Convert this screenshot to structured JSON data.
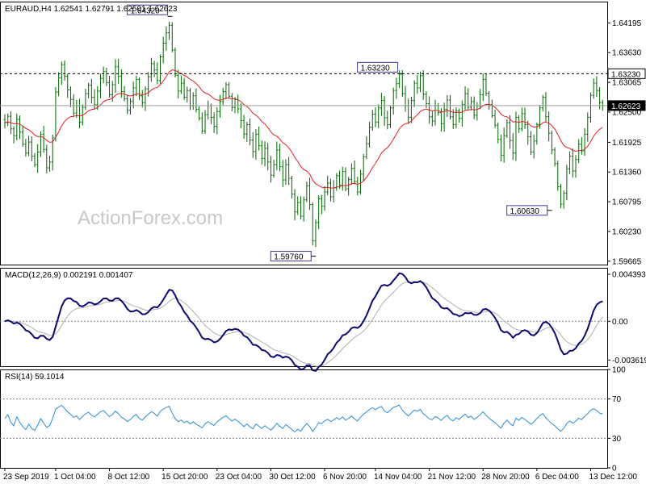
{
  "chart_data": {
    "type": "bar",
    "header": "EURAUD,H4  1.62541 1.62791 1.62501 1.62623",
    "watermark": "ActionForex.com",
    "colors": {
      "price": "#006400",
      "ema": "#e02020",
      "macd": "#0a0a70",
      "signal": "#b0b0b0",
      "rsi": "#2e8bd8",
      "frame": "#000000"
    },
    "price_axis": {
      "range": [
        1.596,
        1.646
      ],
      "ticks": [
        "1.64195",
        "1.63630",
        "1.63065",
        "1.62500",
        "1.61925",
        "1.61360",
        "1.60795",
        "1.60230",
        "1.59665"
      ],
      "tick_values": [
        1.64195,
        1.6363,
        1.63065,
        1.625,
        1.61925,
        1.6136,
        1.60795,
        1.6023,
        1.59665
      ],
      "current": "1.62623",
      "current_value": 1.62623,
      "level": "1.63230",
      "level_value": 1.6323
    },
    "callouts": [
      {
        "text": "1.64320",
        "value": 1.6432,
        "session": 55
      },
      {
        "text": "1.63230",
        "value": 1.6323,
        "session": 132
      },
      {
        "text": "1.59760",
        "value": 1.5976,
        "session": 103
      },
      {
        "text": "1.60630",
        "value": 1.6063,
        "session": 182
      }
    ],
    "price_series": {
      "closes": [
        1.623,
        1.6242,
        1.6218,
        1.6205,
        1.6236,
        1.6212,
        1.6189,
        1.6172,
        1.6193,
        1.6166,
        1.615,
        1.6174,
        1.6208,
        1.6179,
        1.6144,
        1.6155,
        1.6201,
        1.6288,
        1.6315,
        1.634,
        1.6318,
        1.6292,
        1.6274,
        1.6248,
        1.6262,
        1.6231,
        1.6259,
        1.6285,
        1.6301,
        1.6278,
        1.6264,
        1.629,
        1.6314,
        1.6327,
        1.6306,
        1.6283,
        1.6302,
        1.6336,
        1.6318,
        1.6289,
        1.6275,
        1.6254,
        1.627,
        1.6296,
        1.6312,
        1.6281,
        1.6268,
        1.6294,
        1.6317,
        1.6342,
        1.633,
        1.631,
        1.6355,
        1.6381,
        1.6401,
        1.6415,
        1.6368,
        1.632,
        1.629,
        1.6305,
        1.6278,
        1.6291,
        1.6262,
        1.6281,
        1.6255,
        1.6238,
        1.6214,
        1.6245,
        1.6262,
        1.624,
        1.6223,
        1.6251,
        1.627,
        1.6289,
        1.6302,
        1.628,
        1.6259,
        1.6274,
        1.6256,
        1.6234,
        1.6208,
        1.6226,
        1.6197,
        1.6175,
        1.6208,
        1.6186,
        1.6162,
        1.6181,
        1.6155,
        1.613,
        1.615,
        1.6178,
        1.6146,
        1.6121,
        1.615,
        1.6124,
        1.6094,
        1.606,
        1.6078,
        1.6052,
        1.6083,
        1.611,
        1.6074,
        1.6005,
        1.604,
        1.6085,
        1.6071,
        1.6098,
        1.6115,
        1.6089,
        1.6106,
        1.6129,
        1.6111,
        1.6137,
        1.6104,
        1.6122,
        1.6143,
        1.6118,
        1.6098,
        1.6132,
        1.6165,
        1.619,
        1.6221,
        1.6246,
        1.6231,
        1.6258,
        1.6272,
        1.6239,
        1.6226,
        1.6258,
        1.6291,
        1.6304,
        1.6322,
        1.6285,
        1.6262,
        1.624,
        1.6272,
        1.6305,
        1.6296,
        1.6319,
        1.6284,
        1.6266,
        1.6241,
        1.6233,
        1.6262,
        1.6249,
        1.6228,
        1.6255,
        1.6273,
        1.6241,
        1.6226,
        1.6252,
        1.6238,
        1.6264,
        1.6285,
        1.6259,
        1.627,
        1.6244,
        1.6262,
        1.6283,
        1.6312,
        1.6286,
        1.6264,
        1.6243,
        1.6225,
        1.6198,
        1.6168,
        1.6205,
        1.623,
        1.6196,
        1.6172,
        1.624,
        1.6218,
        1.6247,
        1.6226,
        1.6203,
        1.6174,
        1.6195,
        1.6226,
        1.6258,
        1.6278,
        1.6241,
        1.621,
        1.6178,
        1.6152,
        1.6108,
        1.6075,
        1.6096,
        1.6142,
        1.6166,
        1.6138,
        1.616,
        1.6189,
        1.6176,
        1.6208,
        1.624,
        1.6282,
        1.6305,
        1.6291,
        1.6268,
        1.6262
      ]
    },
    "macd": {
      "label": "MACD(12,26,9) 0.002191 0.001407",
      "range": [
        -0.0042,
        0.005
      ],
      "ticks": [
        "0.004393",
        "0.00",
        "-0.003619"
      ],
      "tick_values": [
        0.004393,
        0.0,
        -0.003619
      ]
    },
    "rsi": {
      "label": "RSI(14) 59.1014",
      "range": [
        0,
        100
      ],
      "ticks": [
        "100",
        "70",
        "30",
        "0"
      ],
      "tick_values": [
        100,
        70,
        30,
        0
      ]
    },
    "time_axis": {
      "labels": [
        "23 Sep 2019",
        "1 Oct 04:00",
        "8 Oct 12:00",
        "15 Oct 20:00",
        "23 Oct 04:00",
        "30 Oct 12:00",
        "6 Nov 20:00",
        "14 Nov 04:00",
        "21 Nov 12:00",
        "28 Nov 20:00",
        "6 Dec 04:00",
        "13 Dec 12:00"
      ],
      "sessions": [
        0,
        17,
        35,
        53,
        71,
        89,
        107,
        124,
        142,
        160,
        178,
        196
      ]
    }
  }
}
